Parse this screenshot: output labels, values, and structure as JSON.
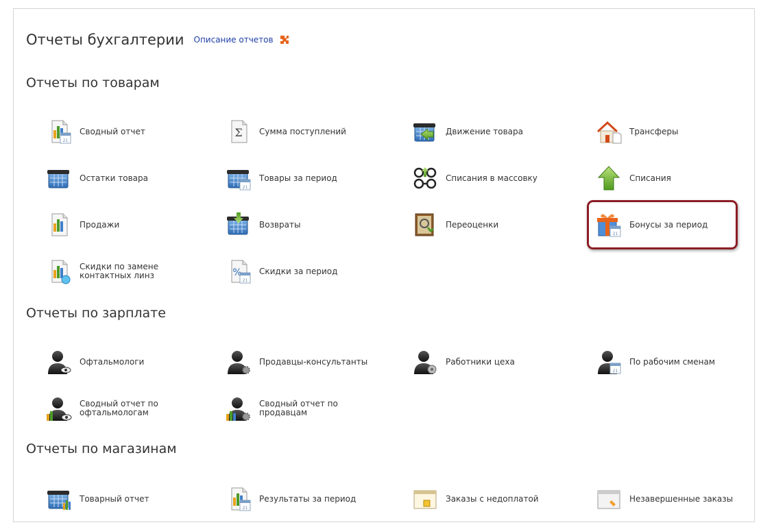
{
  "header": {
    "title": "Отчеты бухгалтерии",
    "description_link": "Описание отчетов",
    "accent_color": "#e8641b"
  },
  "sections": [
    {
      "title": "Отчеты по товарам",
      "items": [
        {
          "label": "Сводный отчет",
          "icon": "summary-report-icon"
        },
        {
          "label": "Сумма поступлений",
          "icon": "sigma-icon"
        },
        {
          "label": "Движение товара",
          "icon": "goods-movement-icon"
        },
        {
          "label": "Трансферы",
          "icon": "house-transfer-icon"
        },
        {
          "label": "Остатки товара",
          "icon": "basket-stock-icon"
        },
        {
          "label": "Товары за период",
          "icon": "basket-period-icon"
        },
        {
          "label": "Списания в массовку",
          "icon": "glasses-writeoff-icon"
        },
        {
          "label": "Списания",
          "icon": "green-arrow-up-icon"
        },
        {
          "label": "Продажи",
          "icon": "sales-chart-icon"
        },
        {
          "label": "Возвраты",
          "icon": "basket-return-icon"
        },
        {
          "label": "Переоценки",
          "icon": "revaluation-icon"
        },
        {
          "label": "Бонусы за период",
          "icon": "gift-calendar-icon"
        },
        {
          "label": "Скидки по замене\nконтактных линз",
          "icon": "lens-discount-icon"
        },
        {
          "label": "Скидки за период",
          "icon": "percent-calendar-icon"
        }
      ]
    },
    {
      "title": "Отчеты по зарплате",
      "items": [
        {
          "label": "Офтальмологи",
          "icon": "person-eye-icon"
        },
        {
          "label": "Продавцы-консультанты",
          "icon": "person-gear-icon"
        },
        {
          "label": "Работники цеха",
          "icon": "person-tools-icon"
        },
        {
          "label": "По рабочим сменам",
          "icon": "person-calendar-icon"
        },
        {
          "label": "Сводный отчет по\nофтальмологам",
          "icon": "person-chart-eye-icon"
        },
        {
          "label": "Сводный отчет по\nпродавцам",
          "icon": "person-chart-gear-icon"
        }
      ]
    },
    {
      "title": "Отчеты по магазинам",
      "items": [
        {
          "label": "Товарный отчет",
          "icon": "basket-chart-icon"
        },
        {
          "label": "Результаты за период",
          "icon": "results-calendar-icon"
        },
        {
          "label": "Заказы с недоплатой",
          "icon": "order-underpaid-icon"
        },
        {
          "label": "Незавершенные заказы",
          "icon": "order-unfinished-icon"
        }
      ]
    }
  ]
}
